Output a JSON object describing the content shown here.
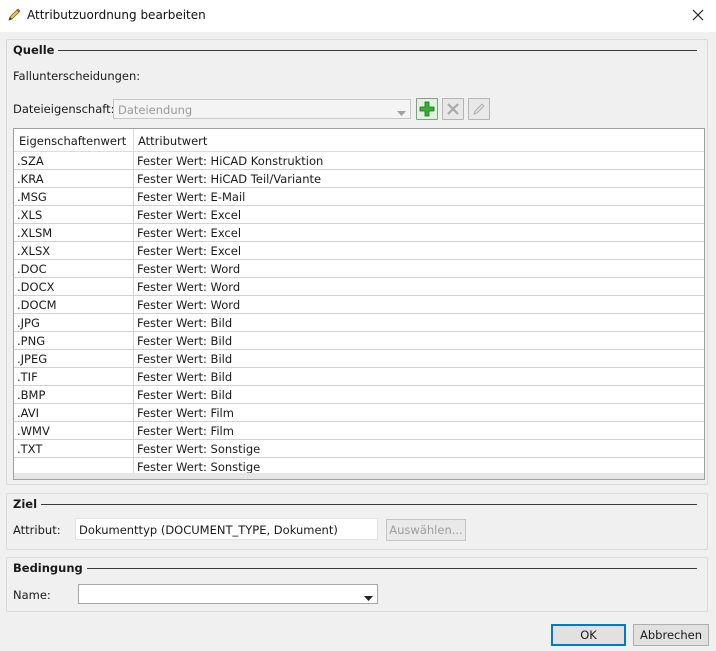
{
  "window": {
    "title": "Attributzuordnung bearbeiten",
    "icon": "pencil-icon",
    "close_icon": "close-icon"
  },
  "source_group": {
    "title": "Quelle",
    "case_label": "Fallunterscheidungen:",
    "file_property_label": "Dateieigenschaft:",
    "file_property_value": "Dateiendung",
    "toolbar": {
      "add_icon": "plus-icon",
      "delete_icon": "delete-x-icon",
      "edit_icon": "pencil-icon"
    },
    "table": {
      "columns": [
        "Eigenschaftenwert",
        "Attributwert"
      ],
      "rows": [
        [
          ".SZA",
          "Fester Wert: HiCAD Konstruktion"
        ],
        [
          ".KRA",
          "Fester Wert: HiCAD Teil/Variante"
        ],
        [
          ".MSG",
          "Fester Wert: E-Mail"
        ],
        [
          ".XLS",
          "Fester Wert: Excel"
        ],
        [
          ".XLSM",
          "Fester Wert: Excel"
        ],
        [
          ".XLSX",
          "Fester Wert: Excel"
        ],
        [
          ".DOC",
          "Fester Wert: Word"
        ],
        [
          ".DOCX",
          "Fester Wert: Word"
        ],
        [
          ".DOCM",
          "Fester Wert: Word"
        ],
        [
          ".JPG",
          "Fester Wert: Bild"
        ],
        [
          ".PNG",
          "Fester Wert: Bild"
        ],
        [
          ".JPEG",
          "Fester Wert: Bild"
        ],
        [
          ".TIF",
          "Fester Wert: Bild"
        ],
        [
          ".BMP",
          "Fester Wert: Bild"
        ],
        [
          ".AVI",
          "Fester Wert: Film"
        ],
        [
          ".WMV",
          "Fester Wert: Film"
        ],
        [
          ".TXT",
          "Fester Wert: Sonstige"
        ],
        [
          "",
          "Fester Wert: Sonstige"
        ]
      ]
    }
  },
  "target_group": {
    "title": "Ziel",
    "attribute_label": "Attribut:",
    "attribute_value": "Dokumenttyp (DOCUMENT_TYPE, Dokument)",
    "select_button": "Auswählen..."
  },
  "condition_group": {
    "title": "Bedingung",
    "name_label": "Name:",
    "name_value": ""
  },
  "footer": {
    "ok": "OK",
    "cancel": "Abbrechen"
  },
  "colors": {
    "add_green": "#2e9d2e",
    "default_button_border": "#0078d7",
    "dialog_background": "#f0f0f0"
  }
}
